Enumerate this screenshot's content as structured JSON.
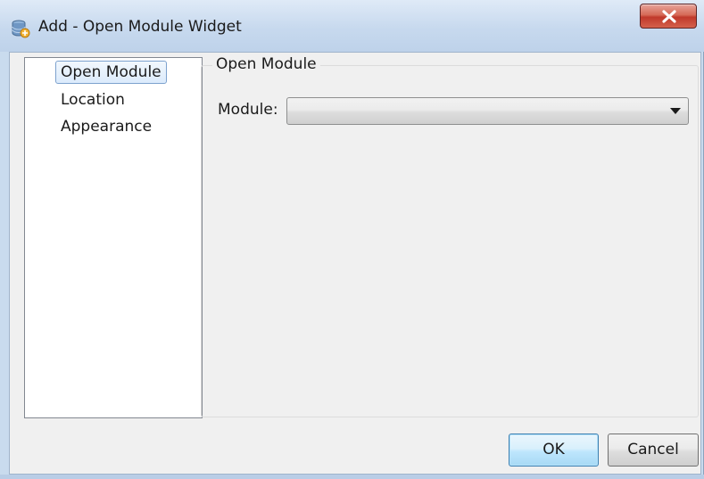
{
  "window": {
    "title": "Add - Open Module Widget",
    "close_symbol": "X"
  },
  "nav": {
    "items": [
      {
        "label": "Open Module",
        "selected": true
      },
      {
        "label": "Location",
        "selected": false
      },
      {
        "label": "Appearance",
        "selected": false
      }
    ]
  },
  "panel": {
    "group_title": "Open Module",
    "module_label": "Module:",
    "module_value": ""
  },
  "buttons": {
    "ok_label": "OK",
    "cancel_label": "Cancel"
  },
  "icons": {
    "title_icon": "database-app-icon",
    "close_icon": "close-icon",
    "dropdown_icon": "dropdown-arrow-icon"
  },
  "colors": {
    "titlebar": "#c7d9ee",
    "close_button": "#c0392b",
    "selection_border": "#7da2ce",
    "ok_border": "#3c7fb1"
  }
}
